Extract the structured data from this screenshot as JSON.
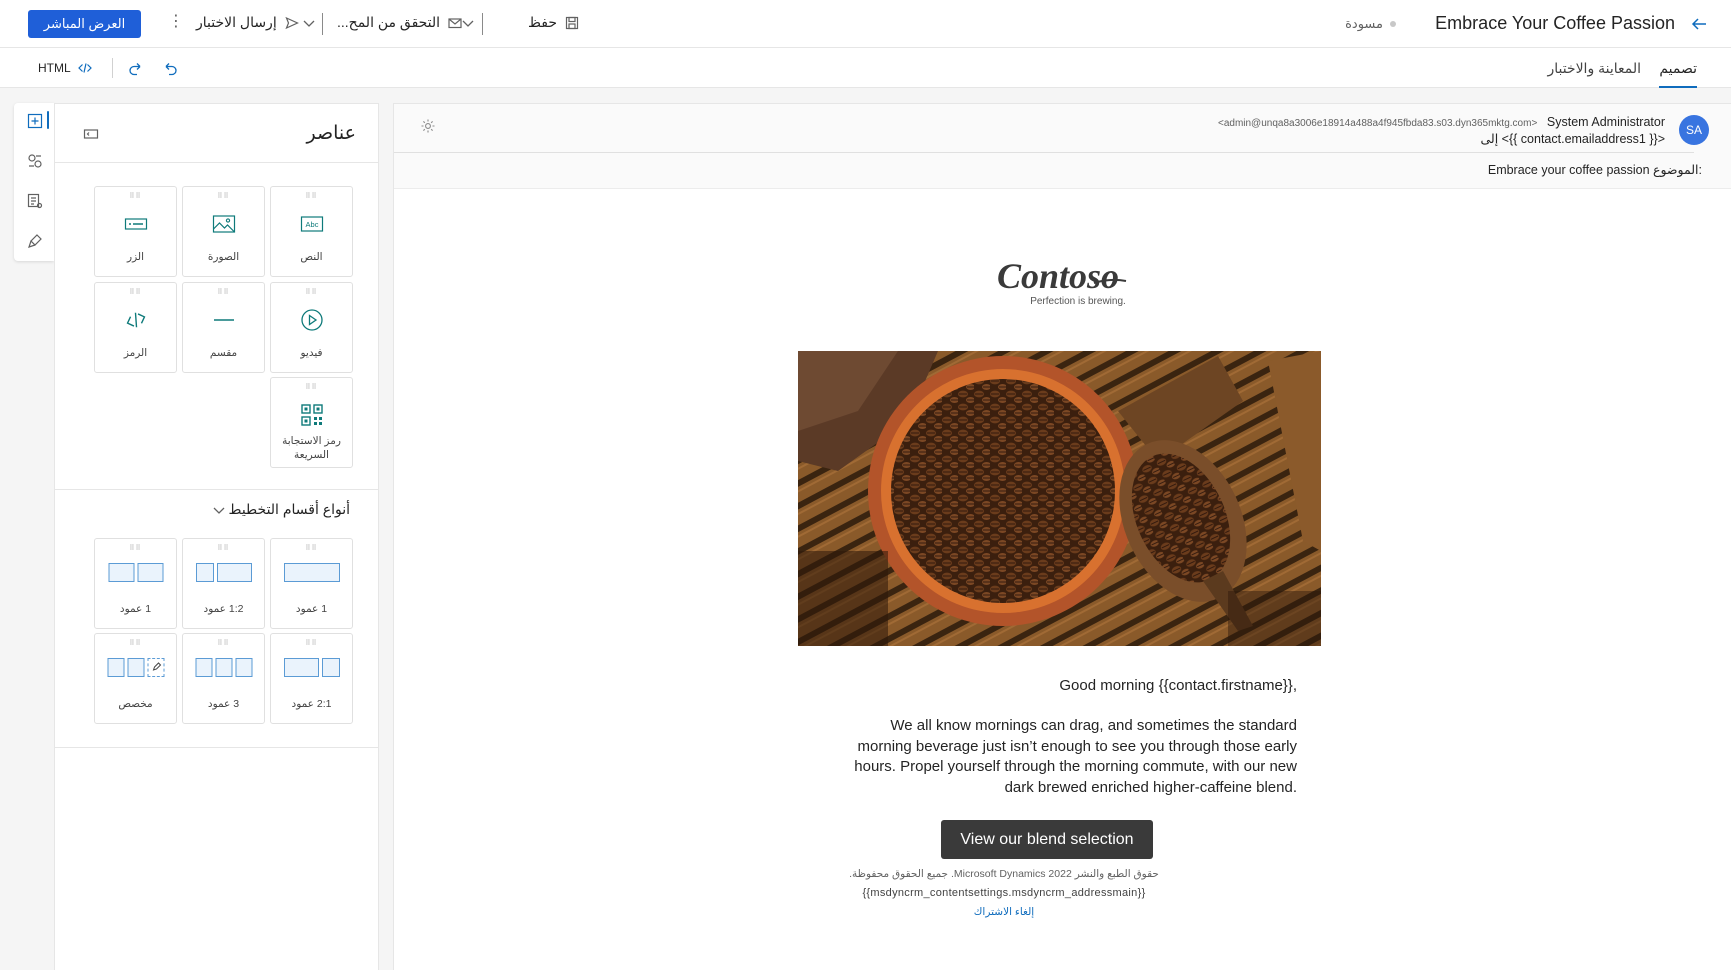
{
  "header": {
    "title": "Embrace Your Coffee Passion",
    "status": "مسودة",
    "save_label": "حفظ",
    "check_label": "التحقق من المح...",
    "send_test_label": "إرسال الاختبار",
    "go_live_label": "العرض المباشر"
  },
  "tabs": [
    {
      "label": "تصميم",
      "active": true
    },
    {
      "label": "المعاينة والاختبار",
      "active": false
    }
  ],
  "toolbar": {
    "html_label": "HTML"
  },
  "panel": {
    "title": "عناصر",
    "elements": [
      {
        "label": "النص",
        "icon": "text-icon"
      },
      {
        "label": "الصورة",
        "icon": "image-icon"
      },
      {
        "label": "الزر",
        "icon": "button-icon"
      },
      {
        "label": "فيديو",
        "icon": "video-icon"
      },
      {
        "label": "مقسم",
        "icon": "divider-icon"
      },
      {
        "label": "الرمز",
        "icon": "code-icon"
      },
      {
        "label": "رمز الاستجابة السريعة",
        "icon": "qr-code-icon"
      }
    ],
    "layouts_title": "أنواع أقسام التخطيط",
    "layouts": [
      {
        "label": "1 عمود"
      },
      {
        "label": "1:2 عمود"
      },
      {
        "label": "1 عمود"
      },
      {
        "label": "2:1 عمود"
      },
      {
        "label": "3 عمود"
      },
      {
        "label": "مخصص"
      }
    ]
  },
  "email": {
    "avatar_initials": "SA",
    "sender_name": "System Administrator",
    "sender_address": "<admin@unqa8a3006e18914a488a4f945fbda83.s03.dyn365mktg.com>",
    "to_line": "إلى <{{ contact.emailaddress1 }}>",
    "subject_label": "الموضوع:",
    "subject": "Embrace your coffee passion",
    "logo_text": "Contoso",
    "logo_tagline": "Perfection is brewing.",
    "greeting": "Good morning {{contact.firstname}},",
    "body": "We all know mornings can drag, and sometimes the standard morning beverage just isn’t enough to see you through those early hours. Propel yourself through the morning commute, with our new dark brewed enriched higher-caffeine blend.",
    "cta_label": "View our blend selection",
    "copyright": "حقوق الطبع والنشر 2022 Microsoft Dynamics. جميع الحقوق محفوظة.",
    "address_token": "{{msdyncrm_contentsettings.msdyncrm_addressmain}}",
    "unsubscribe": "إلغاء الاشتراك"
  },
  "colors": {
    "primary": "#1f5fd8",
    "accent": "#0f6cbd",
    "icon_teal": "#0e7a7a",
    "cta_bg": "#3a3a3a"
  }
}
